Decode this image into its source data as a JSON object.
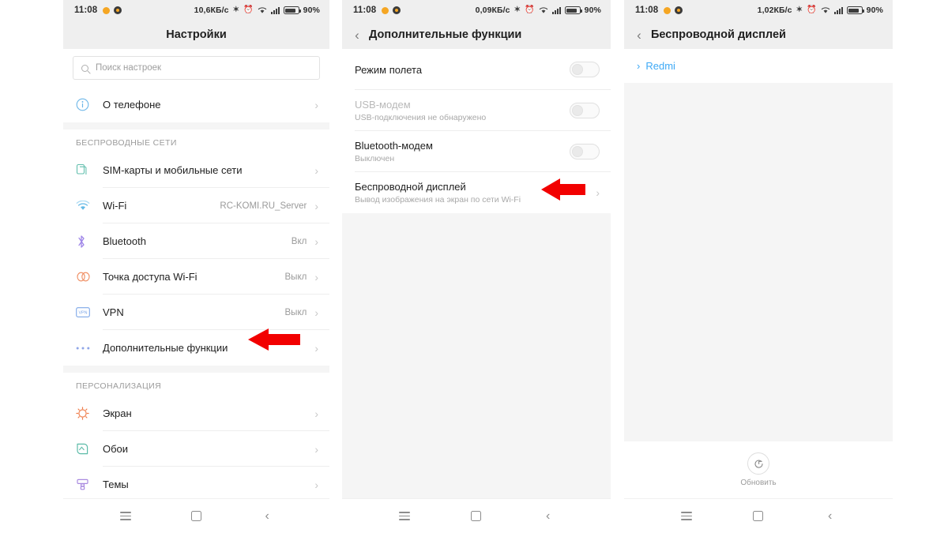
{
  "statusbar": {
    "time": "11:08",
    "icons_left": [
      "orange-dot-icon",
      "dark-dot-icon"
    ],
    "phone1_speed": "10,6КБ/c",
    "phone2_speed": "0,09КБ/c",
    "phone3_speed": "1,02КБ/c",
    "icons_right": [
      "bluetooth-icon",
      "alarm-icon",
      "wifi-icon",
      "signal-icon",
      "battery-icon"
    ],
    "battery_pct": "90%",
    "bluetooth_glyph": "✶",
    "alarm_glyph": "⏰"
  },
  "navbar": {
    "menu": "menu-icon",
    "home": "home-icon",
    "back": "back-icon",
    "back_glyph": "‹"
  },
  "phone1": {
    "title": "Настройки",
    "search": {
      "placeholder": "Поиск настроек",
      "icon": "search-icon"
    },
    "about_row": {
      "label": "О телефоне",
      "value": "",
      "icon": "info-icon"
    },
    "groups": [
      {
        "header": "БЕСПРОВОДНЫЕ СЕТИ",
        "items": [
          {
            "label": "SIM-карты и мобильные сети",
            "value": "",
            "icon": "sim-card-icon"
          },
          {
            "label": "Wi-Fi",
            "value": "RC-KOMI.RU_Server",
            "icon": "wifi-icon"
          },
          {
            "label": "Bluetooth",
            "value": "Вкл",
            "icon": "bluetooth-icon"
          },
          {
            "label": "Точка доступа Wi-Fi",
            "value": "Выкл",
            "icon": "hotspot-icon"
          },
          {
            "label": "VPN",
            "value": "Выкл",
            "icon": "vpn-icon"
          },
          {
            "label": "Дополнительные функции",
            "value": "",
            "icon": "more-options-icon"
          }
        ]
      },
      {
        "header": "ПЕРСОНАЛИЗАЦИЯ",
        "items": [
          {
            "label": "Экран",
            "value": "",
            "icon": "display-icon"
          },
          {
            "label": "Обои",
            "value": "",
            "icon": "wallpaper-icon"
          },
          {
            "label": "Темы",
            "value": "",
            "icon": "themes-icon"
          }
        ]
      }
    ]
  },
  "phone2": {
    "title": "Дополнительные функции",
    "back_glyph": "‹",
    "rows": [
      {
        "title": "Режим полета",
        "sub": "",
        "control": "toggle",
        "dim": false
      },
      {
        "title": "USB-модем",
        "sub": "USB-подключения не обнаружено",
        "control": "toggle",
        "dim": true
      },
      {
        "title": "Bluetooth-модем",
        "sub": "Выключен",
        "control": "toggle",
        "dim": false
      },
      {
        "title": "Беспроводной дисплей",
        "sub": "Вывод изображения на экран по сети Wi-Fi",
        "control": "chevron",
        "dim": false
      }
    ]
  },
  "phone3": {
    "title": "Беспроводной дисплей",
    "back_glyph": "‹",
    "device": {
      "name": "Redmi",
      "chevron": "›"
    },
    "refresh": {
      "label": "Обновить",
      "icon": "refresh-icon"
    }
  },
  "annotations": {
    "arrow_color": "#f20000",
    "arrow1_points_to": "Дополнительные функции",
    "arrow2_points_to": "Беспроводной дисплей"
  }
}
